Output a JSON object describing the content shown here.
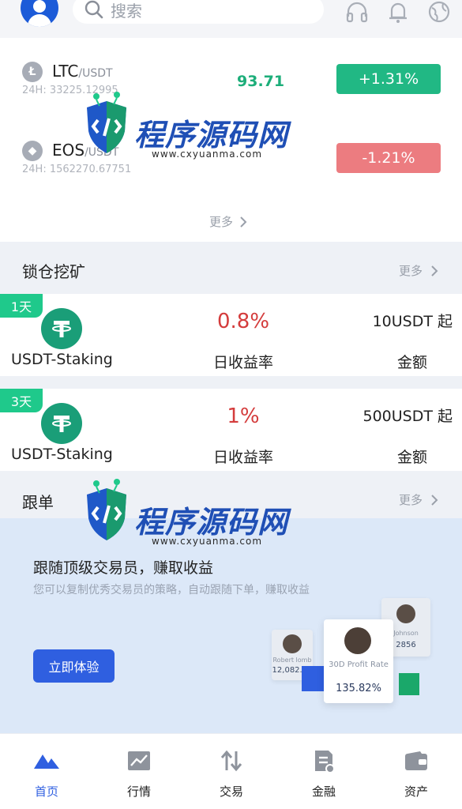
{
  "header": {
    "search_placeholder": "搜索",
    "icons": [
      "avatar-icon",
      "search-icon",
      "headset-icon",
      "bell-icon",
      "globe-icon"
    ]
  },
  "market": {
    "coins": [
      {
        "symbol": "LTC",
        "quote": "/USDT",
        "volume": "24H: 33225.12995",
        "price": "93.71",
        "change": "+1.31%",
        "direction": "up"
      },
      {
        "symbol": "EOS",
        "quote": "/USDT",
        "volume": "24H: 1562270.67751",
        "price": "",
        "change": "-1.21%",
        "direction": "down"
      }
    ],
    "more_label": "更多"
  },
  "staking": {
    "title": "锁仓挖矿",
    "more_label": "更多",
    "items": [
      {
        "days": "1天",
        "name": "USDT-Staking",
        "rate": "0.8%",
        "rate_label": "日收益率",
        "amount": "10USDT 起",
        "amount_label": "金额"
      },
      {
        "days": "3天",
        "name": "USDT-Staking",
        "rate": "1%",
        "rate_label": "日收益率",
        "amount": "500USDT 起",
        "amount_label": "金额"
      }
    ]
  },
  "copy_trading": {
    "title": "跟单",
    "more_label": "更多",
    "headline": "跟随顶级交易员，赚取收益",
    "description": "您可以复制优秀交易员的策略，自动跟随下单，赚取收益",
    "cta": "立即体验",
    "traders": {
      "left": {
        "name": "Robert lomb",
        "value": "12,082.31"
      },
      "main": {
        "metric": "30D Profit Rate",
        "value": "135.82%"
      },
      "right": {
        "name": "Johnson",
        "value": "2856"
      }
    }
  },
  "watermark": {
    "title_part1": "程序",
    "title_part2": "源码网",
    "url": "www.cxyuanma.com"
  },
  "tabbar": {
    "tabs": [
      {
        "label": "首页",
        "icon": "home-mountain-icon",
        "active": true
      },
      {
        "label": "行情",
        "icon": "chart-icon",
        "active": false
      },
      {
        "label": "交易",
        "icon": "swap-arrows-icon",
        "active": false
      },
      {
        "label": "金融",
        "icon": "finance-doc-icon",
        "active": false
      },
      {
        "label": "资产",
        "icon": "wallet-icon",
        "active": false
      }
    ]
  },
  "colors": {
    "up": "#1dae7a",
    "up_badge": "#21b884",
    "down": "#ec7c80",
    "accent": "#2f5fe0",
    "rate_red": "#d43c3c",
    "tag_green": "#1fc98b"
  }
}
